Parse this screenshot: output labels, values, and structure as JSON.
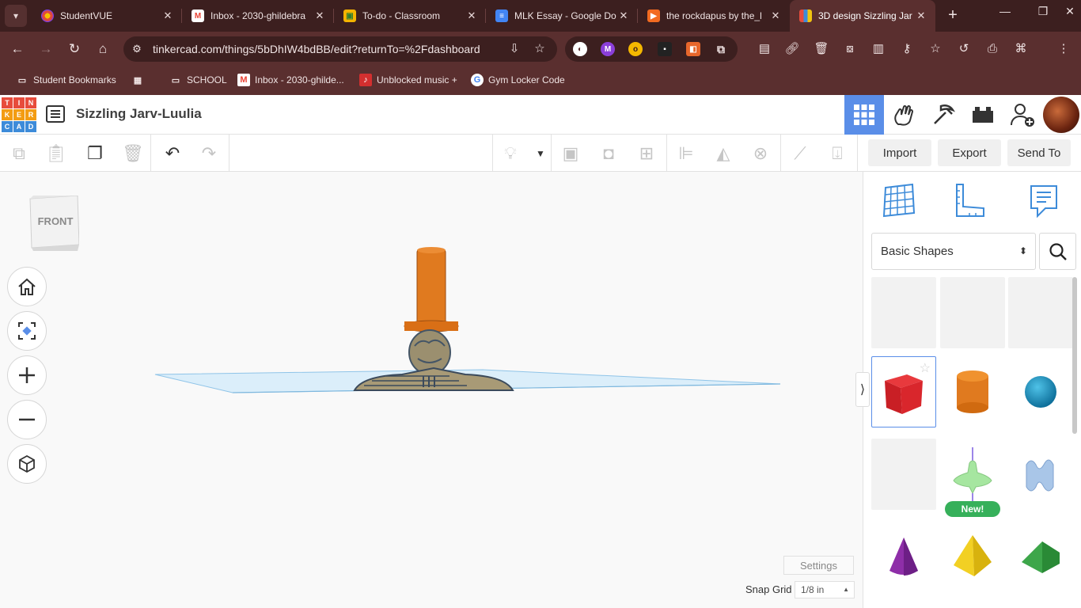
{
  "browser": {
    "tabs": [
      {
        "title": "StudentVUE",
        "favicon": "studentvue-icon",
        "color": "#7b3fe4"
      },
      {
        "title": "Inbox - 2030-ghildebra",
        "favicon": "gmail-icon",
        "color": "#ea4335"
      },
      {
        "title": "To-do - Classroom",
        "favicon": "classroom-icon",
        "color": "#f4b400"
      },
      {
        "title": "MLK Essay - Google Do",
        "favicon": "docs-icon",
        "color": "#4285f4"
      },
      {
        "title": "the rockdapus by the_l",
        "favicon": "app-icon",
        "color": "#f36b21"
      },
      {
        "title": "3D design Sizzling Jar",
        "favicon": "tinkercad-icon",
        "color": "#3d8bd9"
      }
    ],
    "url": "tinkercad.com/things/5bDhIW4bdBB/edit?returnTo=%2Fdashboard",
    "bookmarks": [
      {
        "label": "Student Bookmarks",
        "icon": "managed-folder-icon"
      },
      {
        "label": "",
        "icon": "apps-grid-icon"
      },
      {
        "label": "SCHOOL",
        "icon": "folder-icon"
      },
      {
        "label": "Inbox - 2030-ghilde...",
        "icon": "gmail-icon"
      },
      {
        "label": "Unblocked music +",
        "icon": "music-icon"
      },
      {
        "label": "Gym Locker Code",
        "icon": "google-icon"
      }
    ]
  },
  "app": {
    "logo_letters": [
      "T",
      "I",
      "N",
      "K",
      "E",
      "R",
      "C",
      "A",
      "D"
    ],
    "design_title": "Sizzling Jarv-Luulia",
    "viewcube_label": "FRONT",
    "actions": {
      "import": "Import",
      "export": "Export",
      "send_to": "Send To"
    },
    "settings_label": "Settings",
    "snap_grid_label": "Snap Grid",
    "snap_grid_value": "1/8 in",
    "shape_category": "Basic Shapes",
    "new_badge": "New!",
    "colors": {
      "accent": "#5a8ee8",
      "orange": "#e07a1f",
      "badge_green": "#36b05a"
    }
  }
}
